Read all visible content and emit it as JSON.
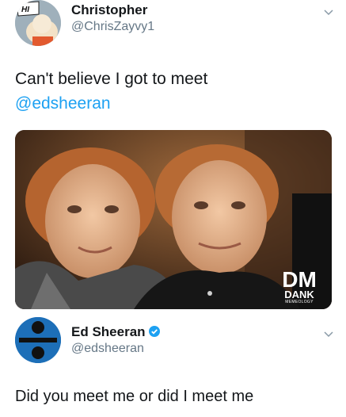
{
  "tweet1": {
    "author_name": "Christopher",
    "author_handle": "@ChrisZayvy1",
    "avatar_badge": "HI",
    "text_line1": "Can't believe I got to meet",
    "text_mention": "@edsheeran",
    "photo_icon": "photo-two-people",
    "watermark": {
      "logo": "DM",
      "line1": "DANK",
      "line2": "MEMEOLOGY"
    }
  },
  "tweet2": {
    "author_name": "Ed Sheeran",
    "author_handle": "@edsheeran",
    "verified": true,
    "text": "Did you meet me or did I meet me"
  },
  "colors": {
    "link": "#1da1f2",
    "handle": "#657786",
    "text": "#14171a",
    "verified": "#1da1f2",
    "ed_avatar_bg": "#1d6fb8"
  }
}
